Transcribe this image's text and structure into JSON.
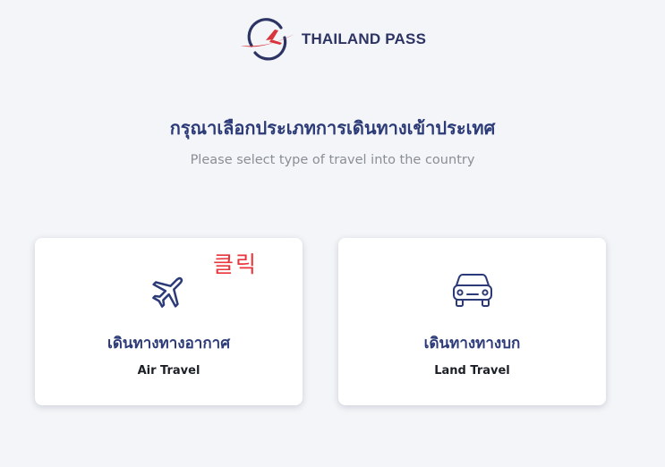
{
  "header": {
    "logo_text": "THAILAND PASS",
    "logo_icon": "airplane-circle-logo"
  },
  "title": "กรุณาเลือกประเภทการเดินทางเข้าประเทศ",
  "subtitle": "Please select type of travel into the country",
  "cards": [
    {
      "icon": "airplane-icon",
      "label_th": "เดินทางทางอากาศ",
      "label_en": "Air Travel"
    },
    {
      "icon": "car-icon",
      "label_th": "เดินทางทางบก",
      "label_en": "Land Travel"
    }
  ],
  "annotation": "클릭",
  "colors": {
    "background": "#f3f5f8",
    "title": "#2c3b78",
    "subtitle": "#8a8e96",
    "logo_red": "#d8343c",
    "logo_navy": "#2d3464",
    "annotation": "#e8343a",
    "card": "#ffffff"
  }
}
